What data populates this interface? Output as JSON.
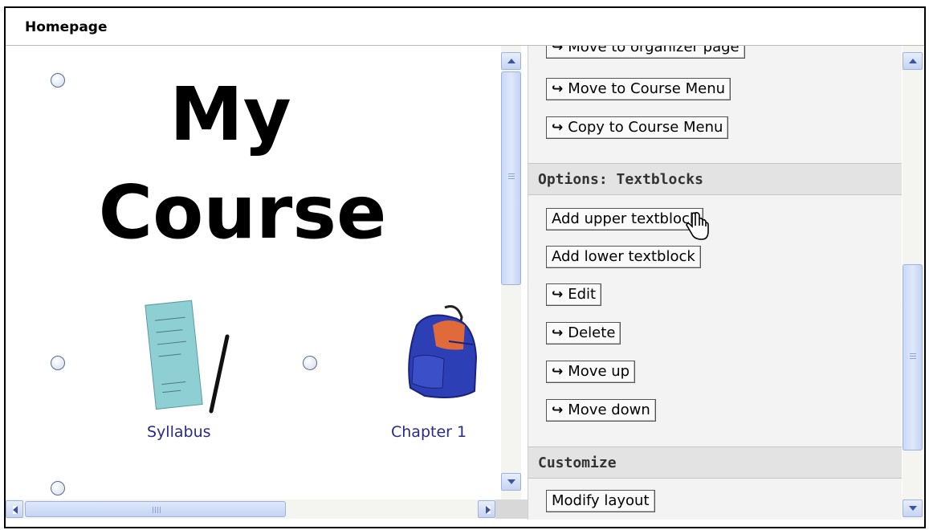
{
  "header": {
    "title": "Homepage"
  },
  "left": {
    "title_line1": "My",
    "title_line2": "Course",
    "items": [
      {
        "label": "Syllabus"
      },
      {
        "label": "Chapter 1"
      }
    ]
  },
  "right": {
    "buttons_top": [
      {
        "label": "Move to organizer page"
      },
      {
        "label": "Move to Course Menu"
      },
      {
        "label": "Copy to Course Menu"
      }
    ],
    "section_textblocks": "Options: Textblocks",
    "textblock_buttons": [
      {
        "label": "Add upper textblock"
      },
      {
        "label": "Add lower textblock"
      },
      {
        "label": "Edit"
      },
      {
        "label": "Delete"
      },
      {
        "label": "Move up"
      },
      {
        "label": "Move down"
      }
    ],
    "section_customize": "Customize",
    "customize_buttons": [
      {
        "label": "Modify layout"
      }
    ]
  },
  "icons": {
    "radio": "radio-button",
    "arrow": "curved-arrow-icon",
    "syllabus": "syllabus-paper-pen-image",
    "chapter": "backpack-image"
  }
}
